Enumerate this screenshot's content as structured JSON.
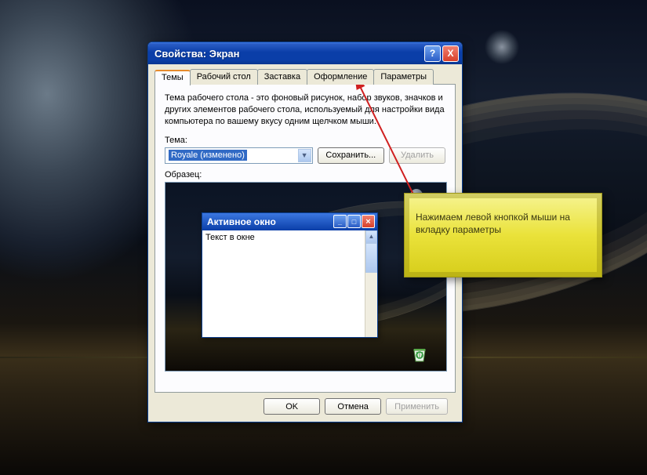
{
  "dialog": {
    "title": "Свойства: Экран",
    "help_symbol": "?",
    "close_symbol": "X",
    "tabs": [
      "Темы",
      "Рабочий стол",
      "Заставка",
      "Оформление",
      "Параметры"
    ],
    "description": "Тема рабочего стола - это фоновый рисунок, набор звуков, значков и других элементов рабочего стола, используемый для настройки вида компьютера по вашему вкусу одним щелчком мыши.",
    "theme_label": "Тема:",
    "theme_selected": "Royale (изменено)",
    "save_btn": "Сохранить...",
    "delete_btn": "Удалить",
    "sample_label": "Образец:",
    "preview_window": {
      "title": "Активное окно",
      "body_text": "Текст в окне"
    },
    "ok": "OK",
    "cancel": "Отмена",
    "apply": "Применить"
  },
  "callout": {
    "text": "Нажимаем левой кнопкой мыши на вкладку параметры"
  }
}
